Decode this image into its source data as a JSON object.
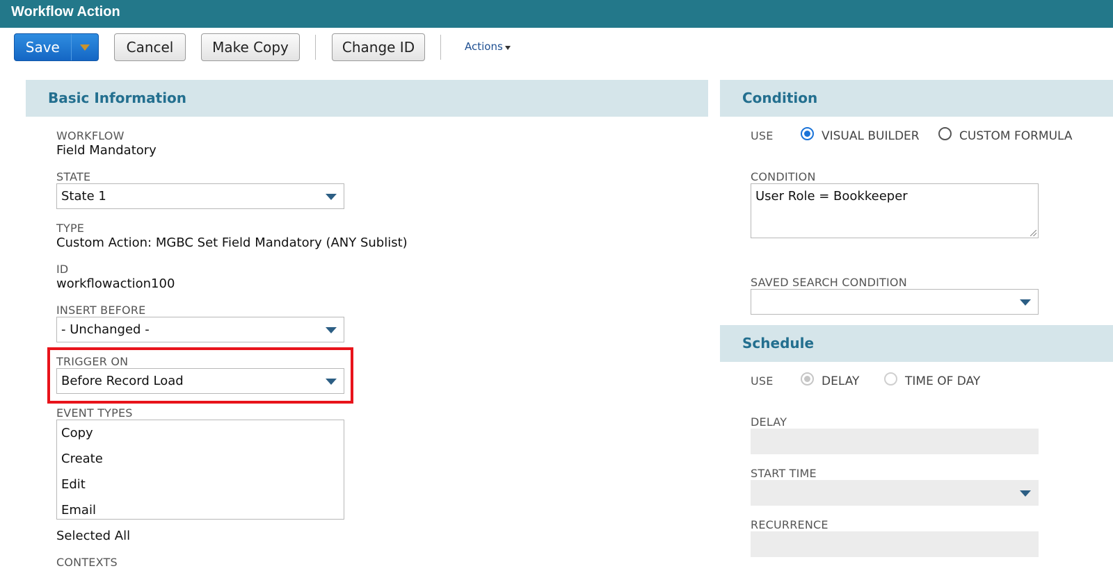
{
  "window": {
    "title": "Workflow Action"
  },
  "toolbar": {
    "save_label": "Save",
    "cancel_label": "Cancel",
    "make_copy_label": "Make Copy",
    "change_id_label": "Change ID",
    "actions_label": "Actions"
  },
  "basic_info": {
    "header": "Basic Information",
    "workflow_label": "WORKFLOW",
    "workflow_value": "Field Mandatory",
    "state_label": "STATE",
    "state_value": "State 1",
    "type_label": "TYPE",
    "type_value": "Custom Action: MGBC Set Field Mandatory (ANY Sublist)",
    "id_label": "ID",
    "id_value": "workflowaction100",
    "insert_before_label": "INSERT BEFORE",
    "insert_before_value": "- Unchanged -",
    "trigger_on_label": "TRIGGER ON",
    "trigger_on_value": "Before Record Load",
    "event_types_label": "EVENT TYPES",
    "event_types": [
      "Copy",
      "Create",
      "Edit",
      "Email"
    ],
    "selected_all": "Selected All",
    "contexts_label": "CONTEXTS"
  },
  "condition": {
    "header": "Condition",
    "use_label": "USE",
    "visual_builder_label": "VISUAL BUILDER",
    "custom_formula_label": "CUSTOM FORMULA",
    "selected_mode": "VISUAL BUILDER",
    "condition_label": "CONDITION",
    "condition_value": "User Role = Bookkeeper",
    "saved_search_label": "SAVED SEARCH CONDITION",
    "saved_search_value": ""
  },
  "schedule": {
    "header": "Schedule",
    "use_label": "USE",
    "delay_option_label": "DELAY",
    "time_of_day_label": "TIME OF DAY",
    "selected_mode": "DELAY",
    "delay_label": "DELAY",
    "start_time_label": "START TIME",
    "recurrence_label": "RECURRENCE"
  },
  "colors": {
    "title_bar": "#23788a",
    "save_button": "#1f7ad6",
    "section_header_bg": "#d5e5ea",
    "section_header_text": "#236f8f",
    "highlight": "#e8141b"
  },
  "icons": {
    "save_dropdown": "chevron-down-icon",
    "select_arrow": "triangle-down-icon",
    "actions_caret": "caret-down-icon"
  }
}
